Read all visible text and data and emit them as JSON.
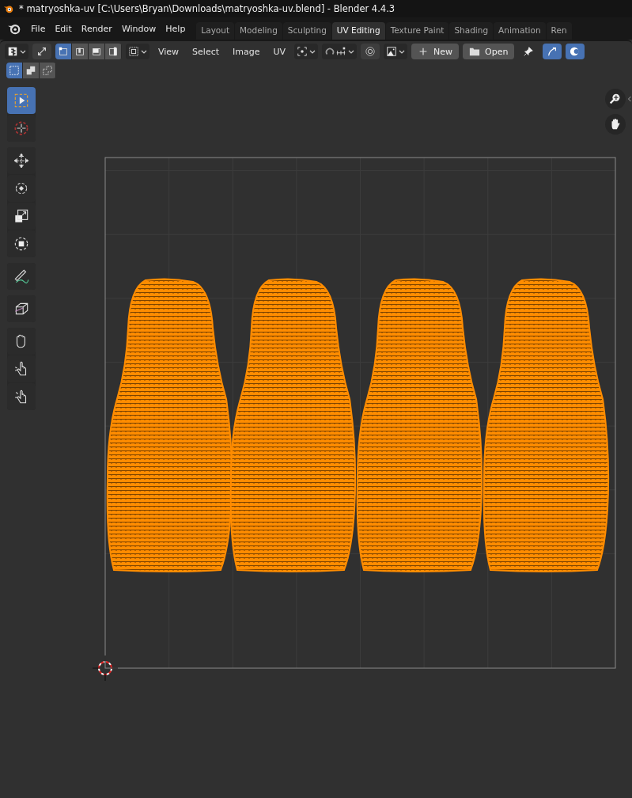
{
  "window": {
    "title": "* matryoshka-uv [C:\\Users\\Bryan\\Downloads\\matryoshka-uv.blend] - Blender 4.4.3"
  },
  "menu": [
    "File",
    "Edit",
    "Render",
    "Window",
    "Help"
  ],
  "workspace_tabs": [
    {
      "label": "Layout",
      "selected": false
    },
    {
      "label": "Modeling",
      "selected": false
    },
    {
      "label": "Sculpting",
      "selected": false
    },
    {
      "label": "UV Editing",
      "selected": true
    },
    {
      "label": "Texture Paint",
      "selected": false
    },
    {
      "label": "Shading",
      "selected": false
    },
    {
      "label": "Animation",
      "selected": false
    },
    {
      "label": "Ren",
      "selected": false
    }
  ],
  "header": {
    "sync_selection": {
      "on": false
    },
    "select_modes": [
      {
        "selected": true
      },
      {
        "selected": false
      },
      {
        "selected": false
      },
      {
        "selected": false
      }
    ],
    "menus": [
      "View",
      "Select",
      "Image",
      "UV"
    ],
    "new_button": "New",
    "open_button": "Open"
  },
  "box_select_modes": [
    {
      "selected": true
    },
    {
      "selected": false
    },
    {
      "selected": false
    }
  ],
  "tool_groups": [
    [
      {
        "kind": "select",
        "selected": true
      },
      {
        "kind": "cursor",
        "selected": false
      }
    ],
    [
      {
        "kind": "move",
        "selected": false
      },
      {
        "kind": "rotate",
        "selected": false
      },
      {
        "kind": "scale",
        "selected": false
      },
      {
        "kind": "transform",
        "selected": false
      }
    ],
    [
      {
        "kind": "annotate",
        "selected": false
      }
    ],
    [
      {
        "kind": "rip",
        "selected": false
      }
    ],
    [
      {
        "kind": "grab",
        "selected": false
      },
      {
        "kind": "relax",
        "selected": false
      },
      {
        "kind": "pinch",
        "selected": false
      }
    ]
  ]
}
